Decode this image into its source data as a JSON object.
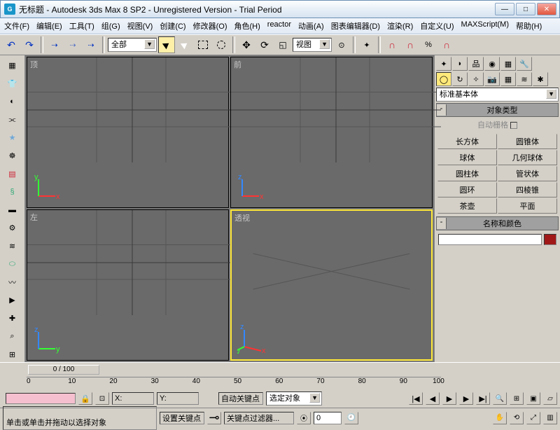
{
  "window": {
    "title": "无标题 - Autodesk 3ds Max 8 SP2  - Unregistered Version - Trial Period"
  },
  "menu": [
    "文件(F)",
    "编辑(E)",
    "工具(T)",
    "组(G)",
    "视图(V)",
    "创建(C)",
    "修改器(O)",
    "角色(H)",
    "reactor",
    "动画(A)",
    "图表编辑器(D)",
    "渲染(R)",
    "自定义(U)",
    "MAXScript(M)",
    "帮助(H)"
  ],
  "toolbar": {
    "sel_filter": "全部",
    "ref_coord": "视图"
  },
  "viewports": {
    "top": "顶",
    "front": "前",
    "left": "左",
    "persp": "透视"
  },
  "create": {
    "category": "标准基本体",
    "roll_objtype": "对象类型",
    "autogrid": "自动栅格",
    "buttons": [
      "长方体",
      "圆锥体",
      "球体",
      "几何球体",
      "圆柱体",
      "管状体",
      "圆环",
      "四棱锥",
      "茶壶",
      "平面"
    ],
    "roll_namecolor": "名称和颜色"
  },
  "timeline": {
    "pos": "0 / 100",
    "ticks": [
      0,
      10,
      20,
      30,
      40,
      50,
      60,
      70,
      80,
      90,
      100
    ]
  },
  "status": {
    "x": "X:",
    "y": "Y:",
    "autokey": "自动关键点",
    "setkey": "设置关键点",
    "selected": "选定对象",
    "keyfilter": "关键点过滤器...",
    "frame": "0",
    "prompt": "单击或单击并拖动以选择对象"
  }
}
